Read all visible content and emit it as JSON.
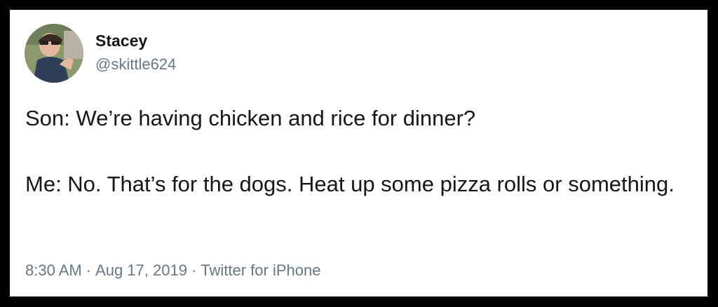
{
  "tweet": {
    "author": {
      "display_name": "Stacey",
      "handle": "@skittle624",
      "avatar_icon": "profile-photo-avatar"
    },
    "text_lines": [
      "Son: We’re having chicken and rice for dinner?",
      "Me: No. That’s for the dogs. Heat up some pizza rolls or something."
    ],
    "time": "8:30 AM",
    "date": "Aug 17, 2019",
    "source": "Twitter for iPhone",
    "separator": "·"
  },
  "colors": {
    "frame": "#000000",
    "card_background": "#ffffff",
    "primary_text": "#14171a",
    "secondary_text": "#657786"
  }
}
